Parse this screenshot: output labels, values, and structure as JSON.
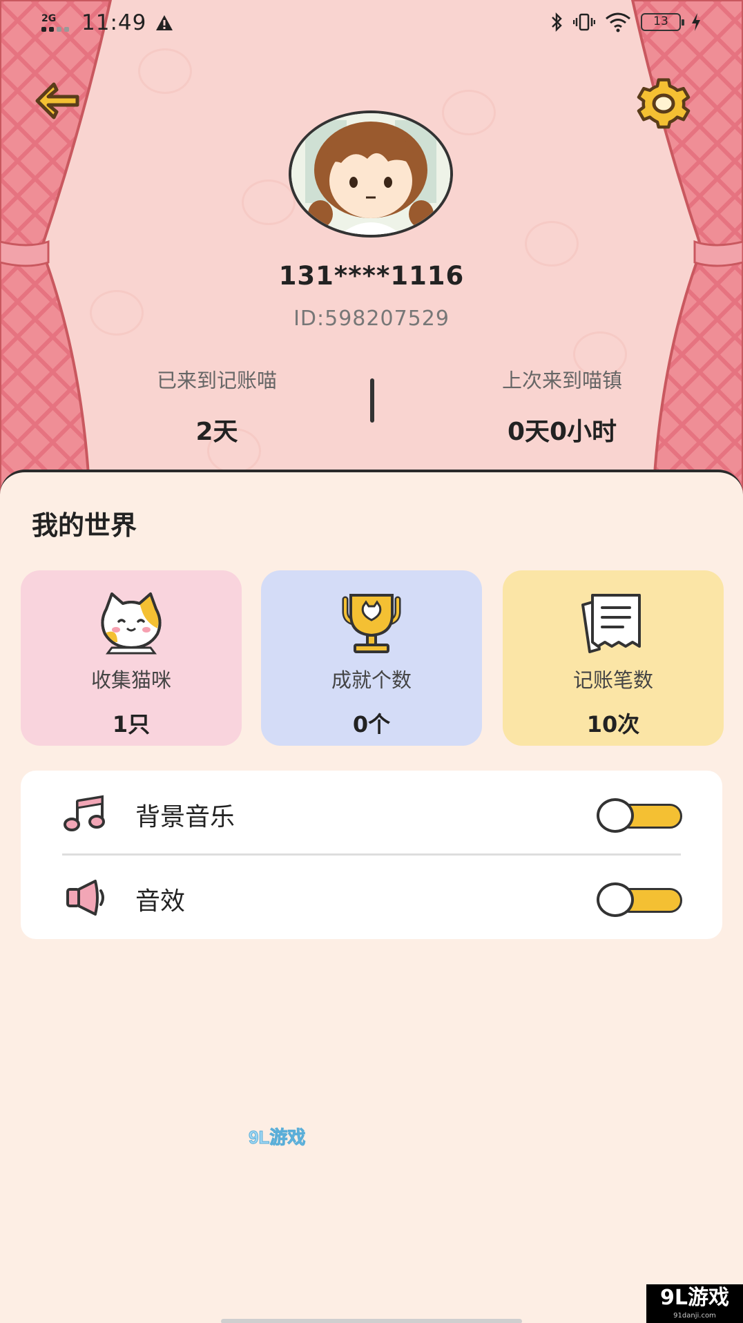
{
  "status_bar": {
    "signal": "2G",
    "time": "11:49",
    "battery": "13"
  },
  "profile": {
    "username": "131****1116",
    "user_id": "ID:598207529",
    "days_label": "已来到记账喵",
    "days_value": "2天",
    "last_visit_label": "上次来到喵镇",
    "last_visit_value": "0天0小时"
  },
  "world": {
    "title": "我的世界",
    "cards": [
      {
        "label": "收集猫咪",
        "value": "1只",
        "icon": "cat-icon",
        "color": "#f9d4dd"
      },
      {
        "label": "成就个数",
        "value": "0个",
        "icon": "trophy-icon",
        "color": "#d4dcf7"
      },
      {
        "label": "记账笔数",
        "value": "10次",
        "icon": "receipt-icon",
        "color": "#fbe5a6"
      }
    ]
  },
  "settings": {
    "music_label": "背景音乐",
    "music_on": true,
    "sfx_label": "音效",
    "sfx_on": true
  },
  "watermark": {
    "text": "9L游戏",
    "sub": "91danji.com"
  },
  "colors": {
    "header_bg": "#f9d4d0",
    "panel_bg": "#fdeee4",
    "toggle_on": "#f4c033",
    "icon_yellow": "#f4c033"
  }
}
